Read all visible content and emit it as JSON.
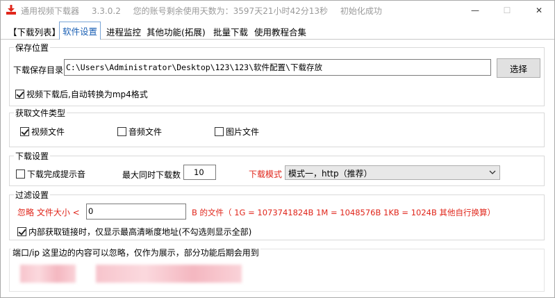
{
  "app": {
    "title": "通用视频下载器",
    "version": "3.3.0.2",
    "account_text": "您的账号剩余使用天数为：3597天21小时42分13秒",
    "status": "初始化成功",
    "icon": "download-arrow-icon",
    "accent": "#e0261b"
  },
  "window_controls": {
    "minimize": "—",
    "maximize": "☐",
    "close": "✕"
  },
  "tabs": [
    {
      "label": "【下载列表】"
    },
    {
      "label": "软件设置"
    },
    {
      "label": "进程监控"
    },
    {
      "label": "其他功能(拓展)"
    },
    {
      "label": "批量下载"
    },
    {
      "label": "使用教程合集"
    }
  ],
  "save": {
    "group_title": "保存位置",
    "dir_label": "下载保存目录",
    "dir_value": "C:\\Users\\Administrator\\Desktop\\123\\123\\软件配置\\下载存放",
    "choose_button": "选择",
    "convert_mp4": "视频下载后,自动转换为mp4格式"
  },
  "filetypes": {
    "group_title": "获取文件类型",
    "video": "视频文件",
    "audio": "音频文件",
    "image": "图片文件"
  },
  "download": {
    "group_title": "下载设置",
    "done_sound": "下载完成提示音",
    "max_label": "最大同时下载数",
    "max_value": "10",
    "mode_label": "下载模式",
    "mode_value": "模式一，http（推荐）"
  },
  "filter": {
    "group_title": "过滤设置",
    "ignore_label": "忽略 文件大小 <",
    "size_value": "0",
    "unit_note": "B 的文件（   1G = 1073741824B    1M = 1048576B   1KB = 1024B    其他自行换算）",
    "hd_only": "内部获取链接时，仅显示最高清晰度地址(不勾选则显示全部)"
  },
  "port": {
    "group_title": "端口/ip 这里边的内容可以忽略，仅作为展示，部分功能后期会用到"
  }
}
